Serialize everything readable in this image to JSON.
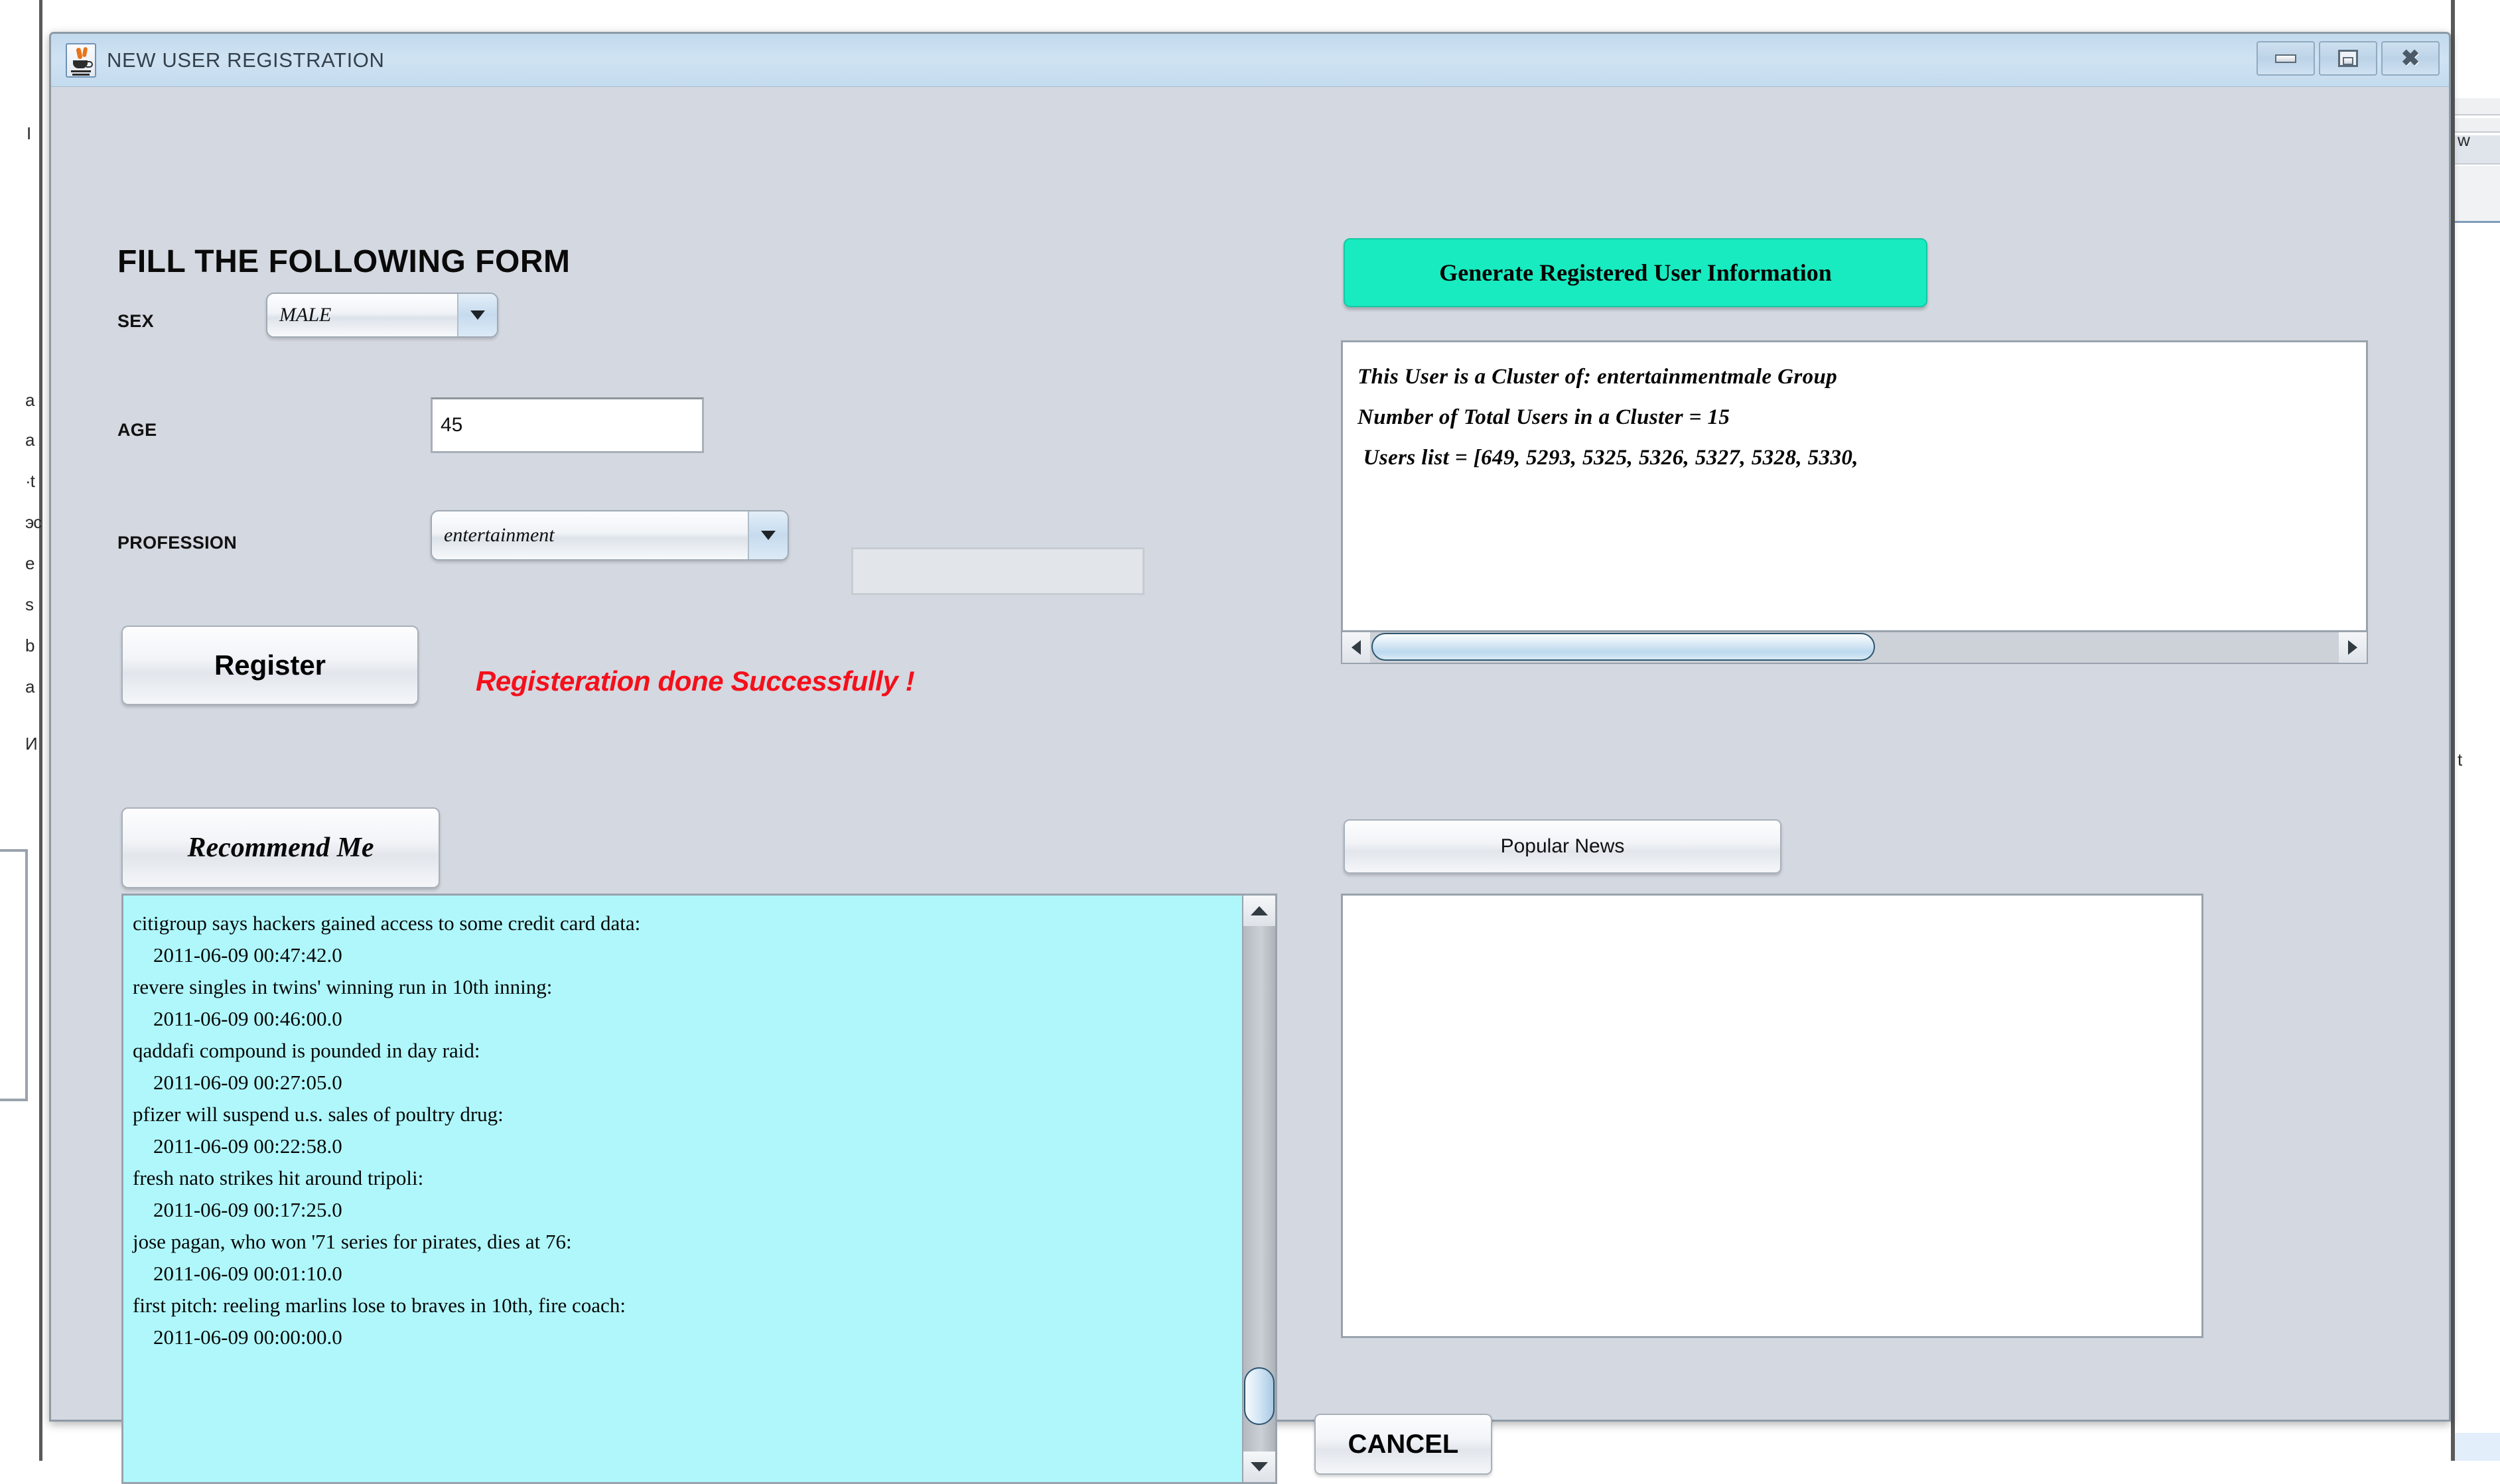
{
  "window": {
    "title": "NEW USER REGISTRATION",
    "app_icon": "java-coffee-cup-icon",
    "controls": {
      "minimize": "minimize-icon",
      "maximize": "maximize-icon",
      "close": "close-icon"
    }
  },
  "form": {
    "heading": "FILL THE FOLLOWING FORM",
    "sex": {
      "label": "SEX",
      "value": "MALE"
    },
    "age": {
      "label": "AGE",
      "value": "45"
    },
    "profession": {
      "label": "PROFESSION",
      "value": "entertainment",
      "extra_field_value": ""
    },
    "register_button": "Register",
    "status_message": "Registeration done Successfully !",
    "status_color": "#f4101b"
  },
  "cluster": {
    "generate_button": "Generate Registered User Information",
    "generate_button_color": "#18ebc0",
    "info_text": "This User is a Cluster of: entertainmentmale Group\nNumber of Total Users in a Cluster = 15\n Users list = [649, 5293, 5325, 5326, 5327, 5328, 5330,",
    "scroll_left_icon": "triangle-left-icon",
    "scroll_right_icon": "triangle-right-icon"
  },
  "recommendations": {
    "button": "Recommend Me",
    "background_color": "#aff7fb",
    "scroll_up_icon": "triangle-up-icon",
    "scroll_down_icon": "triangle-down-icon",
    "items_text": "citigroup says hackers gained access to some credit card data:\n    2011-06-09 00:47:42.0\nrevere singles in twins' winning run in 10th inning:\n    2011-06-09 00:46:00.0\nqaddafi compound is pounded in day raid:\n    2011-06-09 00:27:05.0\npfizer will suspend u.s. sales of poultry drug:\n    2011-06-09 00:22:58.0\nfresh nato strikes hit around tripoli:\n    2011-06-09 00:17:25.0\njose pagan, who won '71 series for pirates, dies at 76:\n    2011-06-09 00:01:10.0\nfirst pitch: reeling marlins lose to braves in 10th, fire coach:\n    2011-06-09 00:00:00.0",
    "items": [
      {
        "headline": "citigroup says hackers gained access to some credit card data:",
        "timestamp": "2011-06-09 00:47:42.0"
      },
      {
        "headline": "revere singles in twins' winning run in 10th inning:",
        "timestamp": "2011-06-09 00:46:00.0"
      },
      {
        "headline": "qaddafi compound is pounded in day raid:",
        "timestamp": "2011-06-09 00:27:05.0"
      },
      {
        "headline": "pfizer will suspend u.s. sales of poultry drug:",
        "timestamp": "2011-06-09 00:22:58.0"
      },
      {
        "headline": "fresh nato strikes hit around tripoli:",
        "timestamp": "2011-06-09 00:17:25.0"
      },
      {
        "headline": "jose pagan, who won '71 series for pirates, dies at 76:",
        "timestamp": "2011-06-09 00:01:10.0"
      },
      {
        "headline": "first pitch: reeling marlins lose to braves in 10th, fire coach:",
        "timestamp": "2011-06-09 00:00:00.0"
      }
    ]
  },
  "popular": {
    "button": "Popular News",
    "output_text": ""
  },
  "footer": {
    "cancel_button": "CANCEL"
  },
  "background_fragments": {
    "left": [
      "I",
      "a",
      "a",
      "·t",
      "эс",
      "е",
      "s",
      "b",
      "a",
      "И"
    ],
    "right": [
      "w",
      "t"
    ]
  }
}
